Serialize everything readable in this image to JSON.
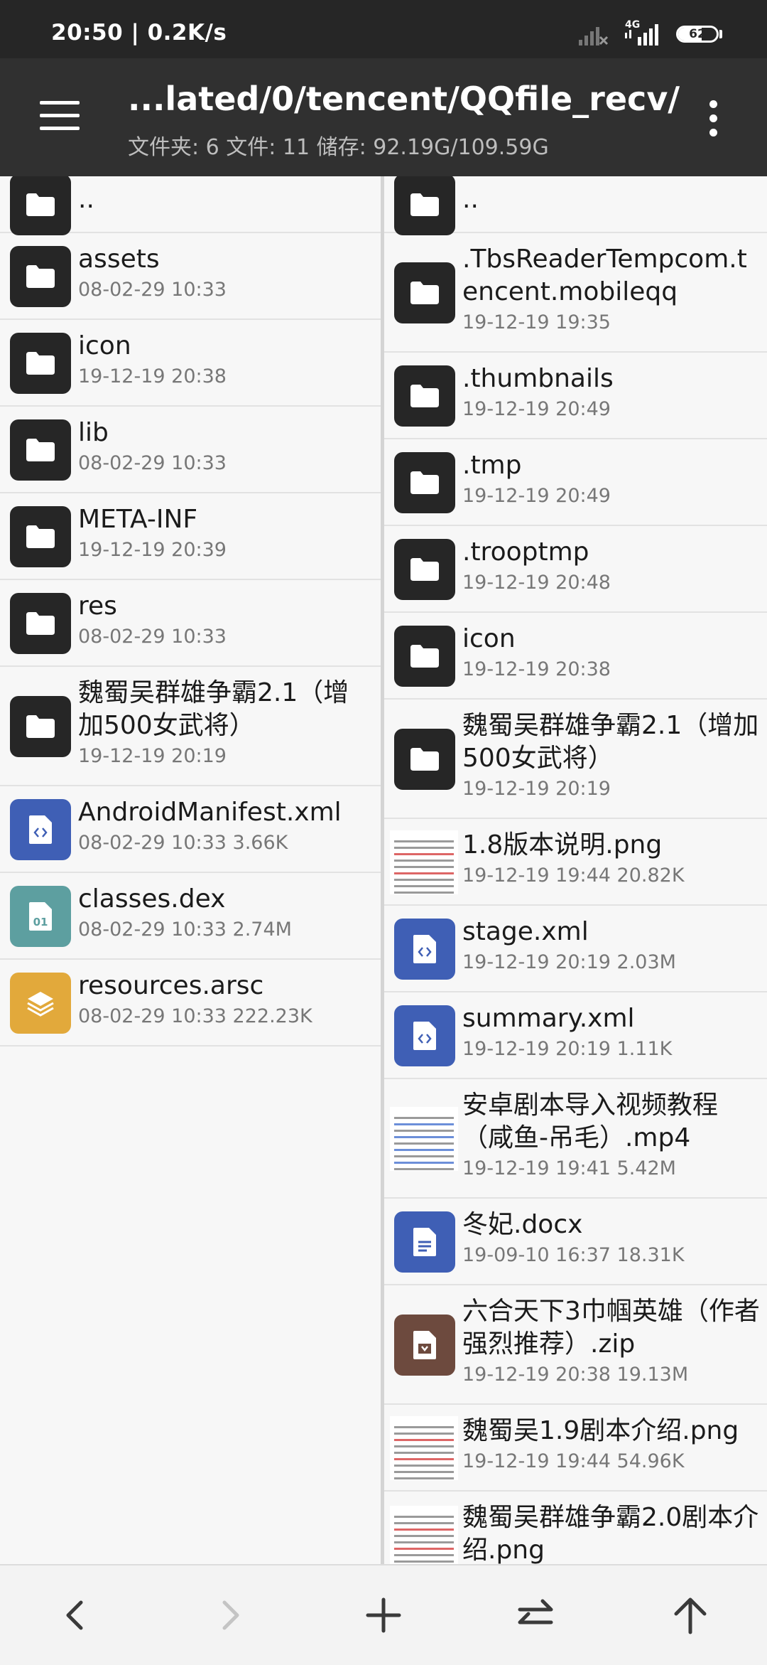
{
  "status_bar": {
    "time_speed": "20:50 | 0.2K/s",
    "network_type": "4G",
    "battery_level": "62"
  },
  "toolbar": {
    "path": "...lated/0/tencent/QQfile_recv/",
    "stats": "文件夹: 6  文件: 11  储存: 92.19G/109.59G"
  },
  "left_pane": [
    {
      "name": "..",
      "meta": "",
      "icon": "folder-icon"
    },
    {
      "name": "assets",
      "meta": "08-02-29 10:33",
      "icon": "folder-icon"
    },
    {
      "name": "icon",
      "meta": "19-12-19 20:38",
      "icon": "folder-icon"
    },
    {
      "name": "lib",
      "meta": "08-02-29 10:33",
      "icon": "folder-icon"
    },
    {
      "name": "META-INF",
      "meta": "19-12-19 20:39",
      "icon": "folder-icon"
    },
    {
      "name": "res",
      "meta": "08-02-29 10:33",
      "icon": "folder-icon"
    },
    {
      "name": "魏蜀吴群雄争霸2.1（增加500女武将）",
      "meta": "19-12-19 20:19",
      "icon": "folder-icon"
    },
    {
      "name": "AndroidManifest.xml",
      "meta": "08-02-29 10:33  3.66K",
      "icon": "code-file-icon"
    },
    {
      "name": "classes.dex",
      "meta": "08-02-29 10:33  2.74M",
      "icon": "binary-file-icon"
    },
    {
      "name": "resources.arsc",
      "meta": "08-02-29 10:33  222.23K",
      "icon": "layers-file-icon"
    }
  ],
  "right_pane": [
    {
      "name": "..",
      "meta": "",
      "icon": "folder-icon"
    },
    {
      "name": ".TbsReaderTempcom.tencent.mobileqq",
      "meta": "19-12-19 19:35",
      "icon": "folder-icon"
    },
    {
      "name": ".thumbnails",
      "meta": "19-12-19 20:49",
      "icon": "folder-icon"
    },
    {
      "name": ".tmp",
      "meta": "19-12-19 20:49",
      "icon": "folder-icon"
    },
    {
      "name": ".trooptmp",
      "meta": "19-12-19 20:48",
      "icon": "folder-icon"
    },
    {
      "name": "icon",
      "meta": "19-12-19 20:38",
      "icon": "folder-icon"
    },
    {
      "name": "魏蜀吴群雄争霸2.1（增加500女武将）",
      "meta": "19-12-19 20:19",
      "icon": "folder-icon"
    },
    {
      "name": "1.8版本说明.png",
      "meta": "19-12-19 19:44  20.82K",
      "icon": "image-thumbnail"
    },
    {
      "name": "stage.xml",
      "meta": "19-12-19 20:19  2.03M",
      "icon": "code-file-icon"
    },
    {
      "name": "summary.xml",
      "meta": "19-12-19 20:19  1.11K",
      "icon": "code-file-icon"
    },
    {
      "name": "安卓剧本导入视频教程（咸鱼-吊毛）.mp4",
      "meta": "19-12-19 19:41  5.42M",
      "icon": "video-thumbnail"
    },
    {
      "name": "冬妃.docx",
      "meta": "19-09-10 16:37  18.31K",
      "icon": "document-file-icon"
    },
    {
      "name": "六合天下3巾帼英雄（作者强烈推荐）.zip",
      "meta": "19-12-19 20:38  19.13M",
      "icon": "archive-file-icon"
    },
    {
      "name": "魏蜀吴1.9剧本介绍.png",
      "meta": "19-12-19 19:44  54.96K",
      "icon": "image-thumbnail"
    },
    {
      "name": "魏蜀吴群雄争霸2.0剧本介绍.png",
      "meta": "",
      "icon": "image-thumbnail"
    }
  ],
  "colors": {
    "folder": "#262626",
    "code_file": "#3f5fb5",
    "binary_file": "#5d9fa0",
    "layers_file": "#e2a93b",
    "document_file": "#3f5fb5",
    "archive_file": "#6d4a3e"
  },
  "bottom_nav": [
    "back-icon",
    "forward-icon",
    "add-icon",
    "swap-icon",
    "up-icon"
  ]
}
